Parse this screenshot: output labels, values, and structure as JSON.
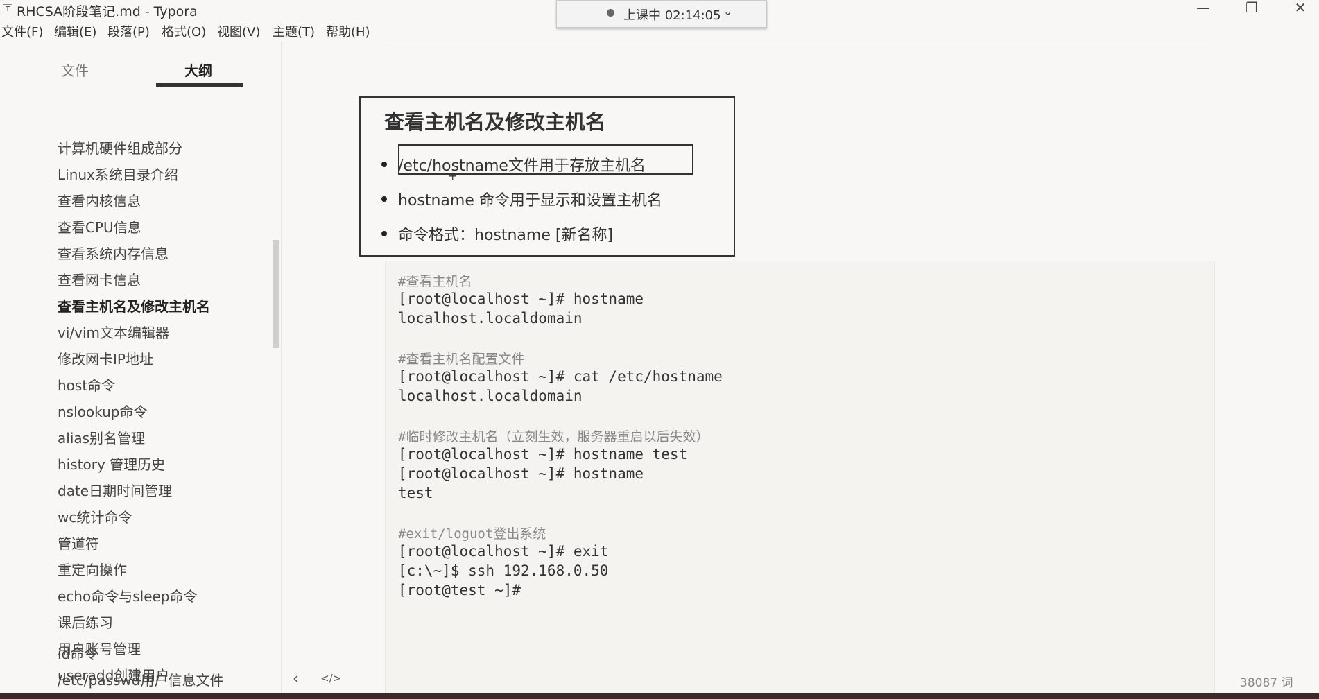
{
  "window": {
    "title": "RHCSA阶段笔记.md - Typora",
    "app_icon": "T",
    "minimize": "—",
    "maximize": "❐",
    "close": "✕"
  },
  "menu": [
    "文件(F)",
    "编辑(E)",
    "段落(P)",
    "格式(O)",
    "视图(V)",
    "主题(T)",
    "帮助(H)"
  ],
  "timer": {
    "label": "上课中 02:14:05",
    "chevron": "⌄"
  },
  "sidebar": {
    "tabs": [
      "文件",
      "大纲"
    ],
    "active_tab": "大纲",
    "items": [
      "计算机硬件组成部分",
      "Linux系统目录介绍",
      "查看内核信息",
      "查看CPU信息",
      "查看系统内存信息",
      "查看网卡信息",
      "查看主机名及修改主机名",
      "vi/vim文本编辑器",
      "修改网卡IP地址",
      "host命令",
      "nslookup命令",
      "alias别名管理",
      "history 管理历史",
      "date日期时间管理",
      "wc统计命令",
      "管道符",
      "重定向操作",
      "echo命令与sleep命令",
      "课后练习",
      "用户账号管理",
      "useradd创建用户",
      "id命令",
      "/etc/passwd用户信息文件"
    ],
    "active_item": "查看主机名及修改主机名"
  },
  "content": {
    "heading": "查看主机名及修改主机名",
    "bullets": [
      "/etc/hostname文件用于存放主机名",
      "hostname 命令用于显示和设置主机名",
      "命令格式：hostname  [新名称]"
    ],
    "code_lines": [
      {
        "text": "#查看主机名",
        "comment": true
      },
      {
        "text": "[root@localhost ~]# hostname",
        "comment": false
      },
      {
        "text": "localhost.localdomain",
        "comment": false
      },
      {
        "text": "",
        "comment": false
      },
      {
        "text": "#查看主机名配置文件",
        "comment": true
      },
      {
        "text": "[root@localhost ~]# cat /etc/hostname",
        "comment": false
      },
      {
        "text": "localhost.localdomain",
        "comment": false
      },
      {
        "text": "",
        "comment": false
      },
      {
        "text": "#临时修改主机名（立刻生效，服务器重启以后失效）",
        "comment": true
      },
      {
        "text": "[root@localhost ~]# hostname test",
        "comment": false
      },
      {
        "text": "[root@localhost ~]# hostname",
        "comment": false
      },
      {
        "text": "test",
        "comment": false
      },
      {
        "text": "",
        "comment": false
      },
      {
        "text": "#exit/loguot登出系统",
        "comment": true
      },
      {
        "text": "[root@localhost ~]# exit",
        "comment": false
      },
      {
        "text": "[c:\\~]$ ssh 192.168.0.50",
        "comment": false
      },
      {
        "text": "[root@test ~]#",
        "comment": false
      }
    ]
  },
  "statusbar": {
    "back_icon": "‹",
    "source_icon": "</>",
    "word_count": "38087 词"
  }
}
